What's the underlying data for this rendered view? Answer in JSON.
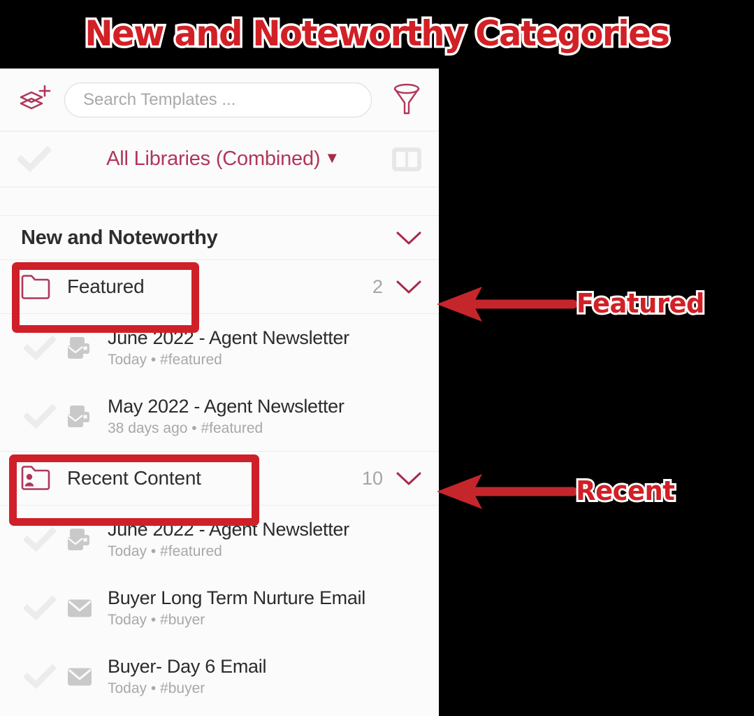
{
  "annotation": {
    "title": "New and Noteworthy Categories",
    "callouts": [
      {
        "label": "Featured",
        "points_to": "featured-folder-row"
      },
      {
        "label": "Recent",
        "points_to": "recent-content-folder-row"
      }
    ],
    "highlight_color": "#cf2029",
    "title_color": "#d12026",
    "title_outline_color": "#ffffff"
  },
  "toolbar": {
    "add_layers_icon": "layers-plus-icon",
    "filter_icon": "funnel-filter-icon",
    "search": {
      "placeholder": "Search Templates ...",
      "value": ""
    }
  },
  "library_row": {
    "check_icon": "checkmark-icon",
    "label": "All Libraries (Combined)",
    "caret": "▼",
    "split_view_icon": "split-panel-icon",
    "accent_color": "#b0375a"
  },
  "section": {
    "title": "New and Noteworthy",
    "collapse_icon": "chevron-down-icon"
  },
  "folders": [
    {
      "name": "Featured",
      "count": "2",
      "icon": "folder-icon",
      "chevron": "chevron-down-icon"
    },
    {
      "name": "Recent Content",
      "count": "10",
      "icon": "folder-user-icon",
      "chevron": "chevron-down-icon"
    }
  ],
  "featured_items": [
    {
      "title": "June 2022 - Agent Newsletter",
      "meta": "Today • #featured",
      "icon": "newsletter-icon",
      "check": "checkmark-icon"
    },
    {
      "title": "May 2022 - Agent Newsletter",
      "meta": "38 days ago • #featured",
      "icon": "newsletter-icon",
      "check": "checkmark-icon"
    }
  ],
  "recent_items": [
    {
      "title": "June 2022 - Agent Newsletter",
      "meta": "Today • #featured",
      "icon": "newsletter-icon",
      "check": "checkmark-icon"
    },
    {
      "title": "Buyer Long Term Nurture Email",
      "meta": "Today • #buyer",
      "icon": "envelope-icon",
      "check": "checkmark-icon"
    },
    {
      "title": "Buyer- Day 6 Email",
      "meta": "Today • #buyer",
      "icon": "envelope-icon",
      "check": "checkmark-icon"
    }
  ],
  "colors": {
    "brand_pink": "#b0375a",
    "panel_bg": "#fbfbfb",
    "muted_text": "#a8a8a8",
    "title_text": "#2d2d2d"
  }
}
